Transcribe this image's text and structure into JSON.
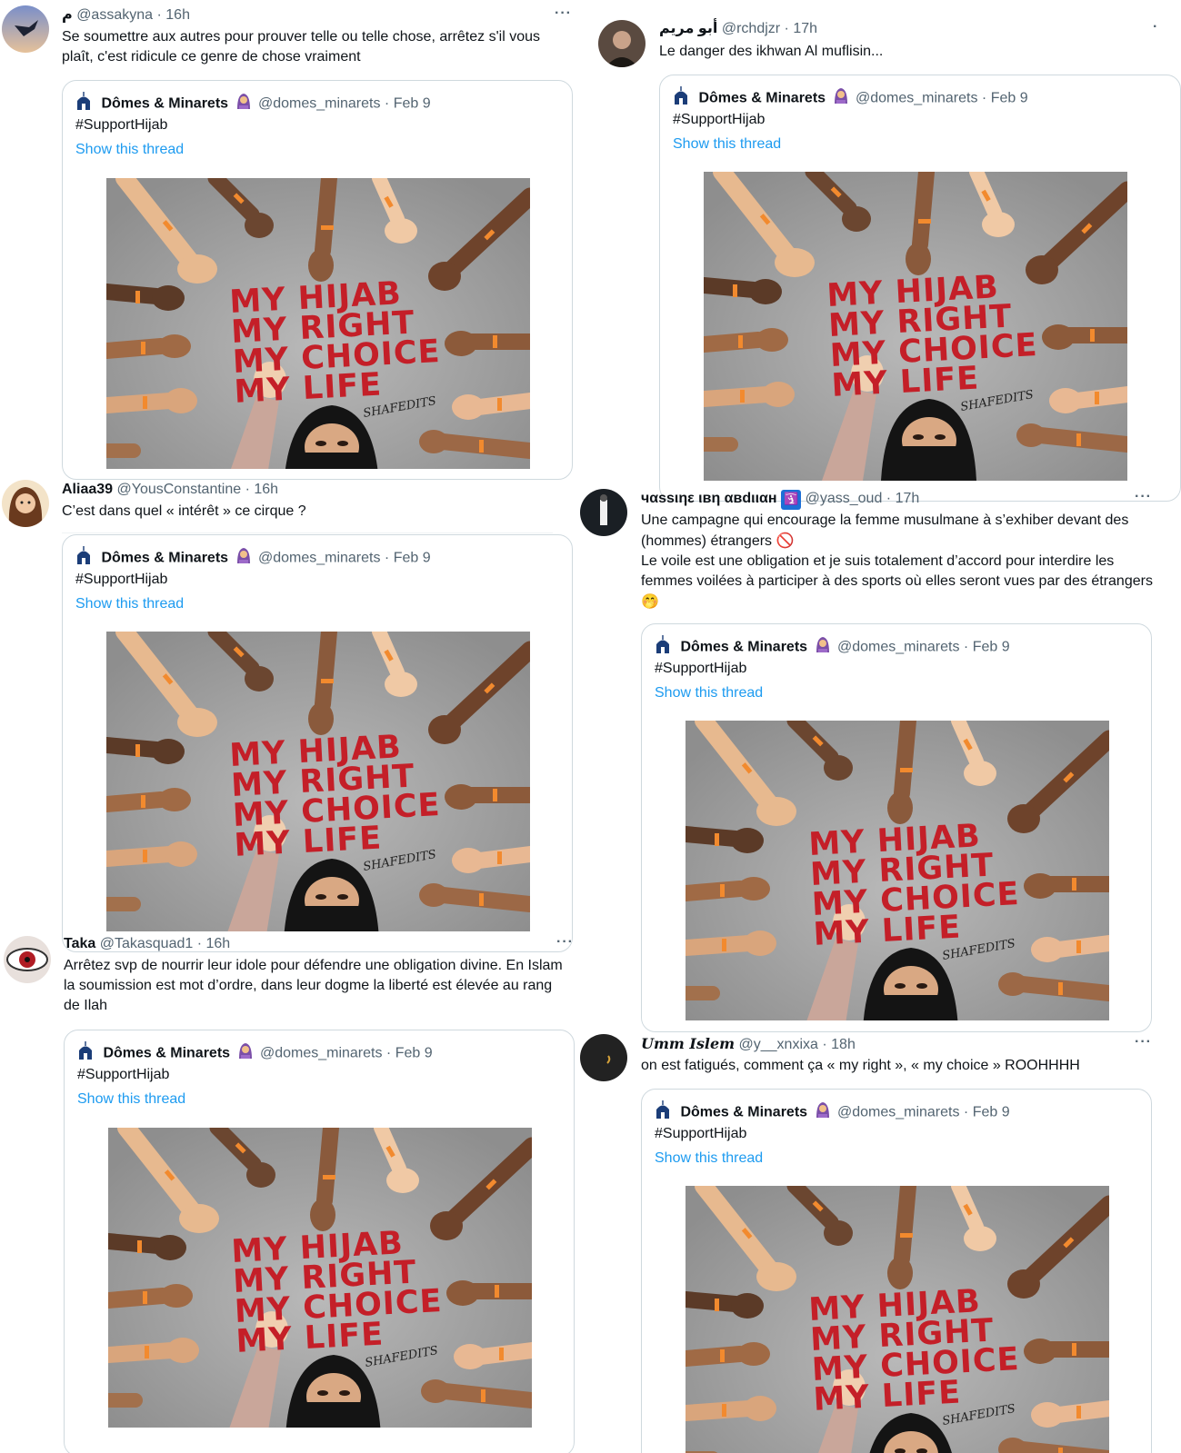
{
  "quoted": {
    "name": "Dômes & Minarets",
    "handle": "@domes_minarets",
    "date": "Feb 9",
    "text": "#SupportHijab",
    "link": "Show this thread",
    "art_lines": "MY HIJAB\nMY RIGHT\nMY CHOICE\nMY LIFE",
    "art_signature": "SHAFEDITS"
  },
  "tweets": [
    {
      "name": "م",
      "handle": "@assakyna",
      "time": "16h",
      "text": "Se soumettre aux autres pour prouver telle ou telle chose, arrêtez s'il vous plaît, c'est ridicule ce genre de chose vraiment",
      "more": "···"
    },
    {
      "name": "أبو مريم",
      "handle": "@rchdjzr",
      "time": "17h",
      "text": "Le danger des ikhwan Al muflisin...",
      "more": "·"
    },
    {
      "name": "Aliaa39",
      "handle": "@YousConstantine",
      "time": "16h",
      "text": "C’est dans quel « intérêt » ce cirque ?"
    },
    {
      "name": "чαssιηε ιвη αвdιιαн",
      "handle": "@yass_oud",
      "time": "17h",
      "badge": "🛐",
      "text1": "Une campagne qui encourage la femme musulmane à s’exhiber devant des (hommes) étrangers",
      "emoji1": "🚫",
      "text2": "Le voile est une obligation et je suis totalement d’accord pour interdire les femmes voilées à participer à des sports où elles seront vues par des étrangers",
      "emoji2": "🤭",
      "more": "···"
    },
    {
      "name": "Taka",
      "handle": "@Takasquad1",
      "time": "16h",
      "text": "Arrêtez svp de nourrir leur idole pour défendre une obligation divine. En Islam la soumission est mot d’ordre, dans leur dogme la liberté est élevée au rang de Ilah",
      "more": "···"
    },
    {
      "name": "Umm Islem",
      "handle": "@y__xnxixa",
      "time": "18h",
      "text": "on est fatigués, comment ça « my right », « my choice » ROOHHHH",
      "more": "···"
    }
  ],
  "colors": {
    "link": "#1d9bf0",
    "secondary_text": "#536471",
    "border": "#cfd9de",
    "paint_red": "#c41f28"
  }
}
